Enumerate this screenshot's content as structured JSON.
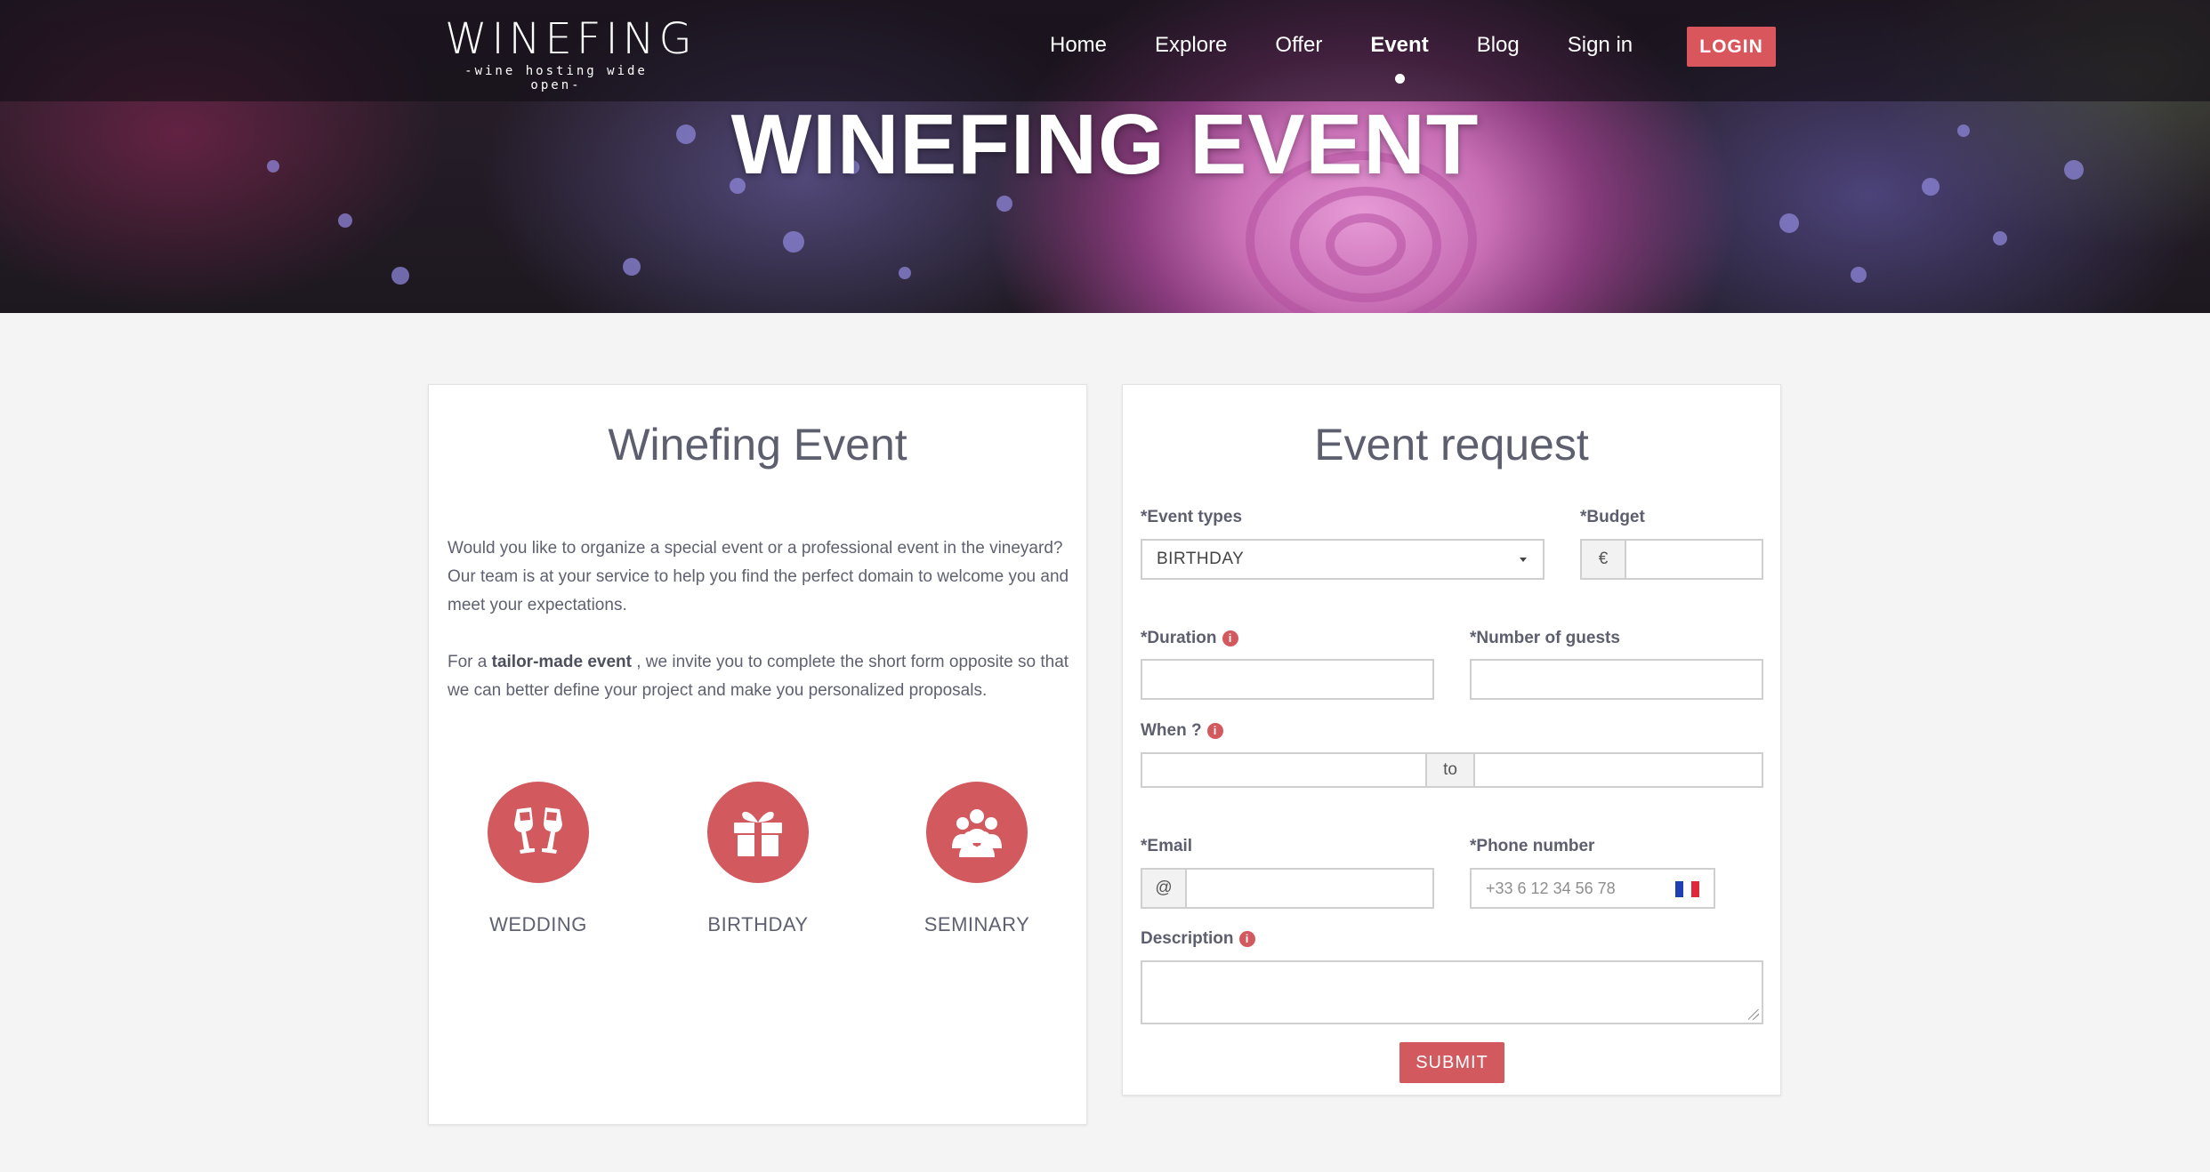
{
  "brand": {
    "name": "WINEFING",
    "tagline": "-wine hosting wide open-"
  },
  "nav": [
    {
      "label": "Home",
      "active": false
    },
    {
      "label": "Explore",
      "active": false
    },
    {
      "label": "Offer",
      "active": false
    },
    {
      "label": "Event",
      "active": true
    },
    {
      "label": "Blog",
      "active": false
    },
    {
      "label": "Sign in",
      "active": false
    }
  ],
  "login_label": "LOGIN",
  "hero_title": "WINEFING EVENT",
  "info_card": {
    "title": "Winefing Event",
    "paragraph1": "Would you like to organize a special event or a professional event in the vineyard? Our team is at your service to help you find the perfect domain to welcome you and meet your expectations.",
    "paragraph2_pre": "For a ",
    "paragraph2_bold": "tailor-made event",
    "paragraph2_post": " , we invite you to complete the short form opposite so that we can better define your project and make you personalized proposals.",
    "types": [
      {
        "label": "WEDDING",
        "icon": "champagne-glasses-icon"
      },
      {
        "label": "BIRTHDAY",
        "icon": "gift-icon"
      },
      {
        "label": "SEMINARY",
        "icon": "group-icon"
      }
    ]
  },
  "form": {
    "title": "Event request",
    "event_types_label": "*Event types",
    "event_types_value": "BIRTHDAY",
    "budget_label": "*Budget",
    "budget_addon": "€",
    "duration_label": "*Duration",
    "guests_label": "*Number of guests",
    "when_label": "When ?",
    "when_separator": "to",
    "email_label": "*Email",
    "email_addon": "@",
    "phone_label": "*Phone number",
    "phone_placeholder": "+33 6 12 34 56 78",
    "description_label": "Description",
    "info_glyph": "i",
    "submit_label": "SUBMIT"
  },
  "colors": {
    "accent": "#d2595e",
    "text": "#5d5f6e",
    "page_bg": "#f4f4f4"
  }
}
